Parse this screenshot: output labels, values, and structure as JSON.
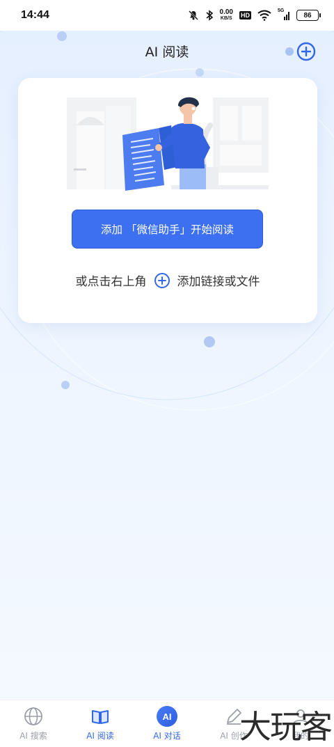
{
  "status_bar": {
    "time": "14:44",
    "net_speed_value": "0.00",
    "net_speed_unit": "KB/S",
    "hd_label": "HD",
    "signal_label": "5G",
    "battery": "86"
  },
  "header": {
    "title": "AI 阅读",
    "add_icon": "plus-circle-icon"
  },
  "card": {
    "primary_button_label": "添加 「微信助手」开始阅读",
    "hint_prefix": "或点击右上角",
    "hint_suffix": "添加链接或文件"
  },
  "tabbar": {
    "items": [
      {
        "label": "AI 搜索",
        "icon": "globe-icon",
        "active": false
      },
      {
        "label": "AI 阅读",
        "icon": "book-icon",
        "active": true
      },
      {
        "label": "AI 对话",
        "icon": "ai-badge-icon",
        "active": true,
        "icon_text": "AI"
      },
      {
        "label": "AI 创作",
        "icon": "pen-icon",
        "active": false
      },
      {
        "label": "我的",
        "icon": "profile-icon",
        "active": false
      }
    ]
  },
  "watermark": "大玩客",
  "colors": {
    "accent": "#3d70f0",
    "background": "#e4efff",
    "tab_active": "#3266e8",
    "tab_inactive": "#9a9ea6"
  }
}
